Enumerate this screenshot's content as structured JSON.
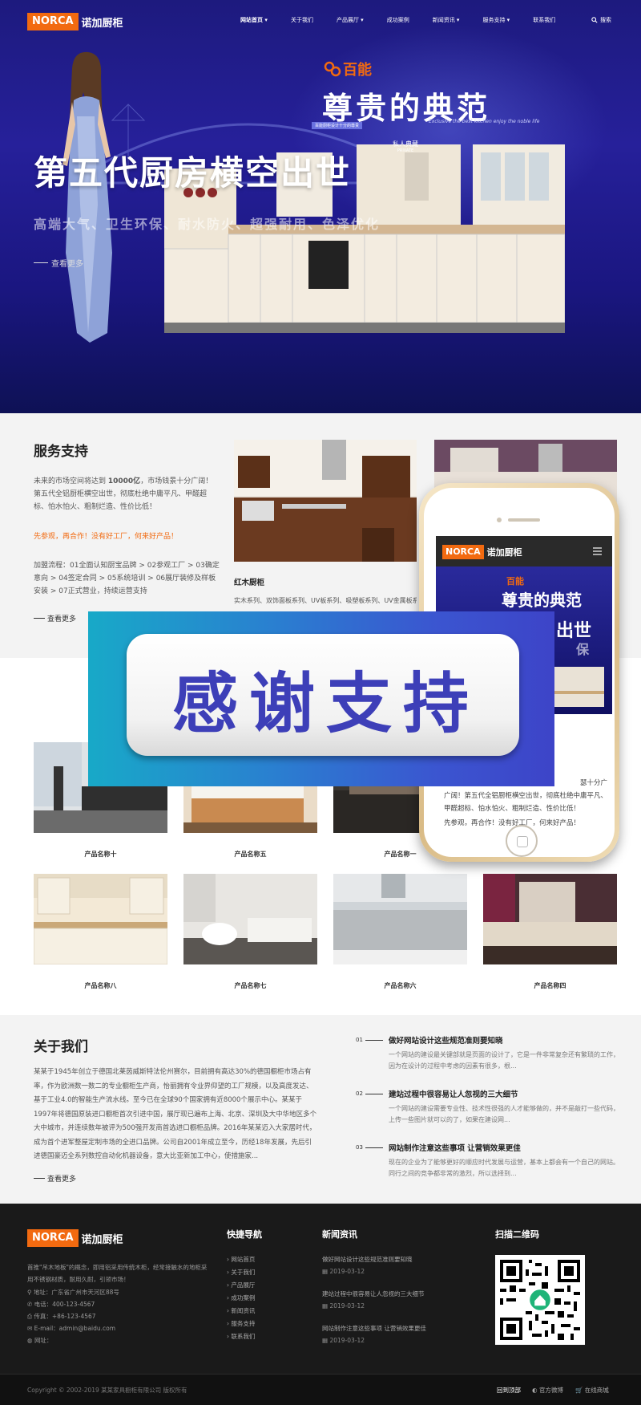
{
  "brand": {
    "logo_en": "NORCA",
    "logo_cn": "诺加厨柜",
    "accent": "#f26a10",
    "hero_bg": "#1d1a7e"
  },
  "nav": {
    "items": [
      "网站首页 ▾",
      "关于我们",
      "产品展厅 ▾",
      "成功案例",
      "新闻资讯 ▾",
      "服务支持 ▾",
      "联系我们"
    ],
    "search_icon": "search-icon",
    "search_label": "搜索"
  },
  "hero": {
    "brand_name": "百能",
    "cn_title": "尊贵的典范",
    "tagline": "百能厨柜设计十分的尊贵",
    "script": "Exclusive the best kitchen enjoy the noble life",
    "private_cn": "私人典藏",
    "private_en": "PRIVATE",
    "title": "第五代厨房横空出世",
    "subtitle": "高端大气、卫生环保、耐水防火、超强耐用、色泽优化",
    "more": "查看更多"
  },
  "service": {
    "title": "服务支持",
    "p1_a": "未来的市场空间将达到 ",
    "p1_b": "10000亿",
    "p1_c": "，市场钱景十分广阔！第五代全铝厨柜横空出世，彻底杜绝中庸平凡、甲醛超标、怕水怕火、粗制烂造、性价比低！",
    "p2": "先参观，再合作！没有好工厂，何来好产品！",
    "p3": "加盟流程：01全面认知厨宝品牌 > 02参观工厂 > 03确定意向 > 04签定合同 > 05系统培训 > 06展厅装修及样板安装 > 07正式营业，持续运营支持",
    "more": "查看更多",
    "card_title": "红木厨柜",
    "card_desc": "实木系列、双饰面板系列、UV板系列、吸塑板系列、UV金属板系列..."
  },
  "products": {
    "row1": [
      "产品名称十",
      "产品名称五",
      "产品名称一"
    ],
    "row2": [
      "产品名称八",
      "产品名称七",
      "产品名称六",
      "产品名称四"
    ]
  },
  "about": {
    "title": "关于我们",
    "text": "某某于1945年创立于德国北莱茵威斯特法伦州赛尔，目前拥有高达30%的德国橱柜市场占有率，作为欧洲数一数二的专业橱柜生产商，怡丽拥有令业界仰望的工厂规模，以及高度发达、基于工业4.0的智能生产流水线。至今已在全球90个国家拥有近8000个展示中心。某某于1997年将德国原装进口橱柜首次引进中国，展厅现已遍布上海、北京、深圳及大中华地区多个大中城市，并连续数年被评为500强开发商首选进口橱柜品牌。2016年某某迈入大家居时代，成为首个进军整屋定制市场的全进口品牌。公司自2001年成立至今，历经18年发展，先后引进德国豪迈全系列数控自动化机器设备，意大比亚新加工中心，使措施家...",
    "more": "查看更多",
    "news": [
      {
        "num": "01",
        "title": "做好网站设计这些规范准则要知晓",
        "desc": "一个网站的建设最关键部就是页面的设计了，它是一件非常复杂还有繁琐的工作，因为在设计的过程中考虑的因素有很多，根..."
      },
      {
        "num": "02",
        "title": "建站过程中很容易让人忽视的三大细节",
        "desc": "一个网站的建设需要专业性、技术性很强的人才能够做的，并不是敲打一些代码，上传一些图片就可以的了，如果在建设网..."
      },
      {
        "num": "03",
        "title": "网站制作注意这些事项 让营销效果更佳",
        "desc": "现在的企业为了能够更好的顺应时代发展与运营，基本上都会有一个自己的网站。同行之间的竞争都非常的激烈，所以选择到..."
      }
    ]
  },
  "footer": {
    "intro": "首推\"吊木地板\"的概念，即用铝采用传统木柜，经常接触水的地柜采用不锈钢材质，耐用久耐，引领市场！",
    "address": "地址：广东省广州市天河区88号",
    "phone": "电话：400-123-4567",
    "fax": "传真：+86-123-4567",
    "email": "E-mail：admin@baidu.com",
    "website": "网址：",
    "quick_nav_title": "快捷导航",
    "quick_nav": [
      "网站首页",
      "关于我们",
      "产品展厅",
      "成功案例",
      "新闻资讯",
      "服务支持",
      "联系我们"
    ],
    "news_title": "新闻资讯",
    "news": [
      {
        "title": "做好网站设计这些规范准则要知晓",
        "date": "2019-03-12"
      },
      {
        "title": "建站过程中很容易让人忽视的三大细节",
        "date": "2019-03-12"
      },
      {
        "title": "网站制作注意这些事项 让营销效果更佳",
        "date": "2019-03-12"
      }
    ],
    "qr_title": "扫描二维码",
    "copyright": "Copyright © 2002-2019 某某家具橱柜有限公司 版权所有",
    "links": [
      "回到顶部",
      "官方微博",
      "在线商城"
    ]
  },
  "overlay": {
    "banner_text": "感谢支持",
    "phone_logo_en": "NORCA",
    "phone_logo_cn": "诺加厨柜",
    "phone_brand": "百能",
    "phone_title": "尊贵的典范",
    "phone_hero_text": "出世",
    "phone_hero_text2": "保",
    "phone_p1": "广阔！第五代全铝厨柜横空出世，彻底杜绝中庸平凡、甲醛超标、怕水怕火、粗制烂造、性价比低！",
    "phone_p1_partial": "瑟十分广",
    "phone_p2": "先参观，再合作！没有好工厂，何来好产品！"
  }
}
